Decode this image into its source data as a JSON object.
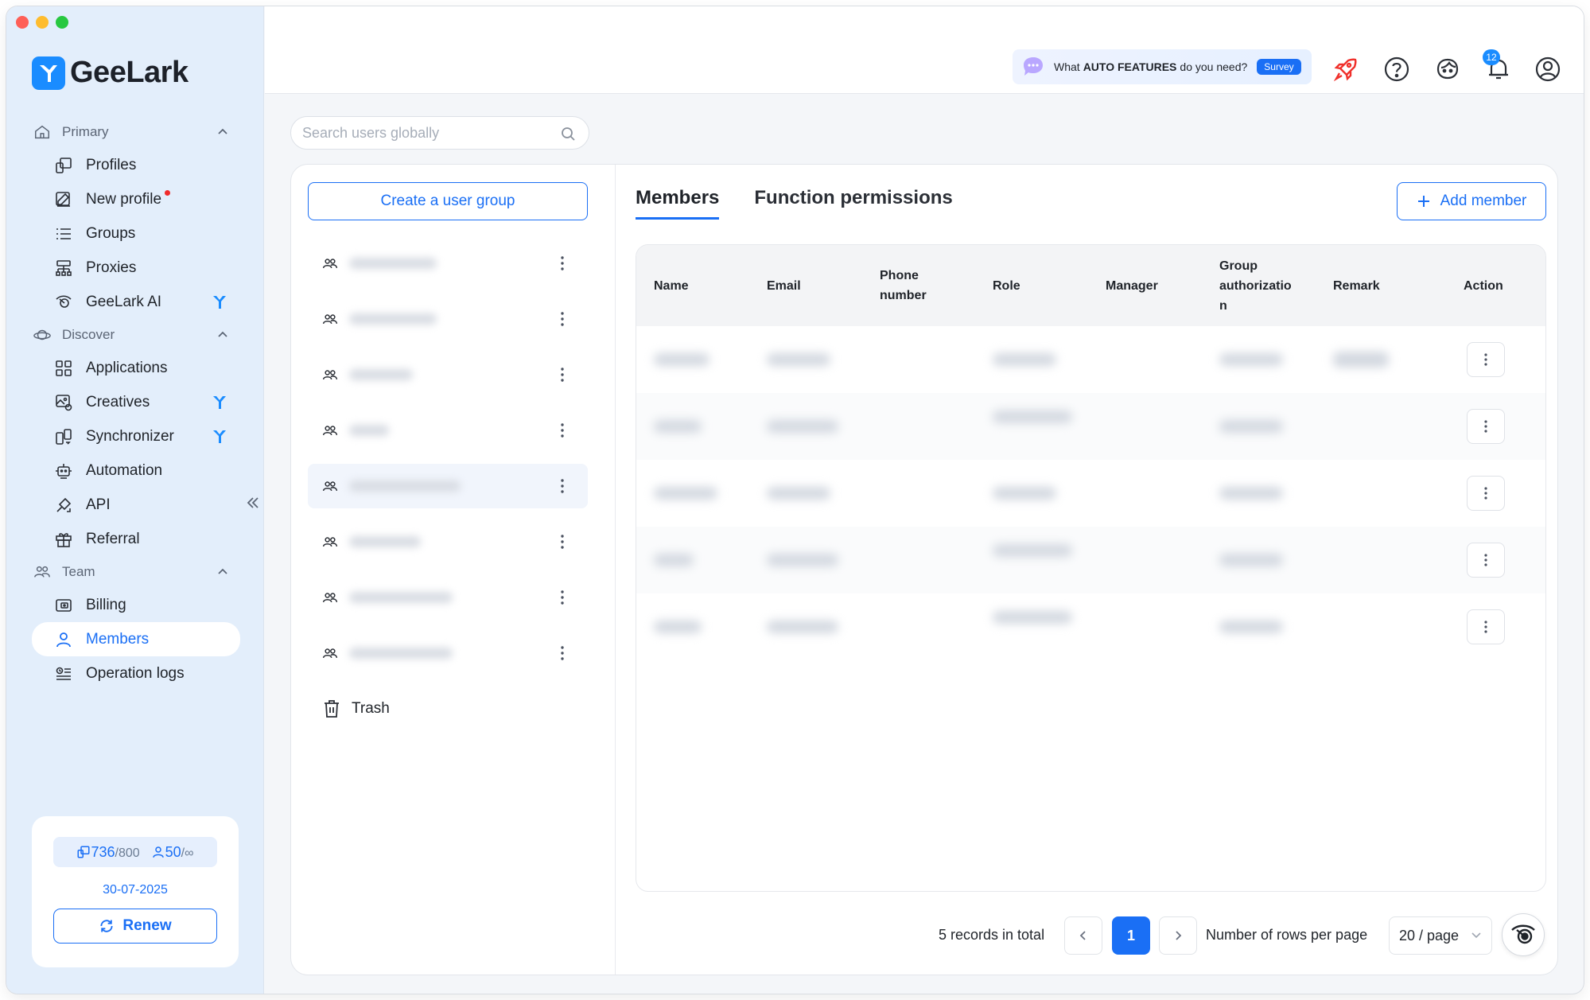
{
  "colors": {
    "accent": "#1a6ff5",
    "brand": "#1a8cff",
    "sidebar_bg": "#e3eefb",
    "notify": "#f02b2b"
  },
  "brand": {
    "name": "GeeLark"
  },
  "sidebar": {
    "sections": [
      {
        "title": "Primary",
        "icon": "home-icon"
      },
      {
        "title": "Discover",
        "icon": "planet-icon"
      },
      {
        "title": "Team",
        "icon": "team-icon"
      }
    ],
    "items": [
      {
        "label": "Profiles",
        "icon": "profiles-icon"
      },
      {
        "label": "New profile",
        "icon": "edit-icon"
      },
      {
        "label": "Groups",
        "icon": "list-icon"
      },
      {
        "label": "Proxies",
        "icon": "proxy-icon"
      },
      {
        "label": "GeeLark AI",
        "icon": "ai-eye-icon"
      },
      {
        "label": "Applications",
        "icon": "apps-grid-icon"
      },
      {
        "label": "Creatives",
        "icon": "creatives-icon"
      },
      {
        "label": "Synchronizer",
        "icon": "sync-icon"
      },
      {
        "label": "Automation",
        "icon": "robot-icon"
      },
      {
        "label": "API",
        "icon": "api-icon"
      },
      {
        "label": "Referral",
        "icon": "gift-icon"
      },
      {
        "label": "Billing",
        "icon": "wallet-icon"
      },
      {
        "label": "Members",
        "icon": "member-icon"
      },
      {
        "label": "Operation logs",
        "icon": "logs-icon"
      }
    ],
    "active_item": "Members"
  },
  "quota": {
    "profiles_used": "736",
    "profiles_total": "/800",
    "members_used": "50",
    "members_total": "/∞",
    "date": "30-07-2025",
    "renew_label": "Renew"
  },
  "topbar": {
    "survey_pre": "What",
    "survey_bold": "AUTO FEATURES",
    "survey_post": "do you need?",
    "survey_badge": "Survey",
    "bell_count": "12"
  },
  "search": {
    "placeholder": "Search users globally"
  },
  "groups": {
    "create_label": "Create a user group",
    "trash_label": "Trash"
  },
  "tabs": [
    {
      "label": "Members"
    },
    {
      "label": "Function permissions"
    }
  ],
  "add_member_label": "Add member",
  "table": {
    "columns": [
      "Name",
      "Email",
      "Phone\nnumber",
      "Role",
      "Manager",
      "Group\nauthorizatio\nn",
      "Remark",
      "Action"
    ]
  },
  "pagination": {
    "total_text": "5 records in total",
    "current_page": "1",
    "rows_label": "Number of rows per page",
    "rows_value": "20 / page"
  }
}
